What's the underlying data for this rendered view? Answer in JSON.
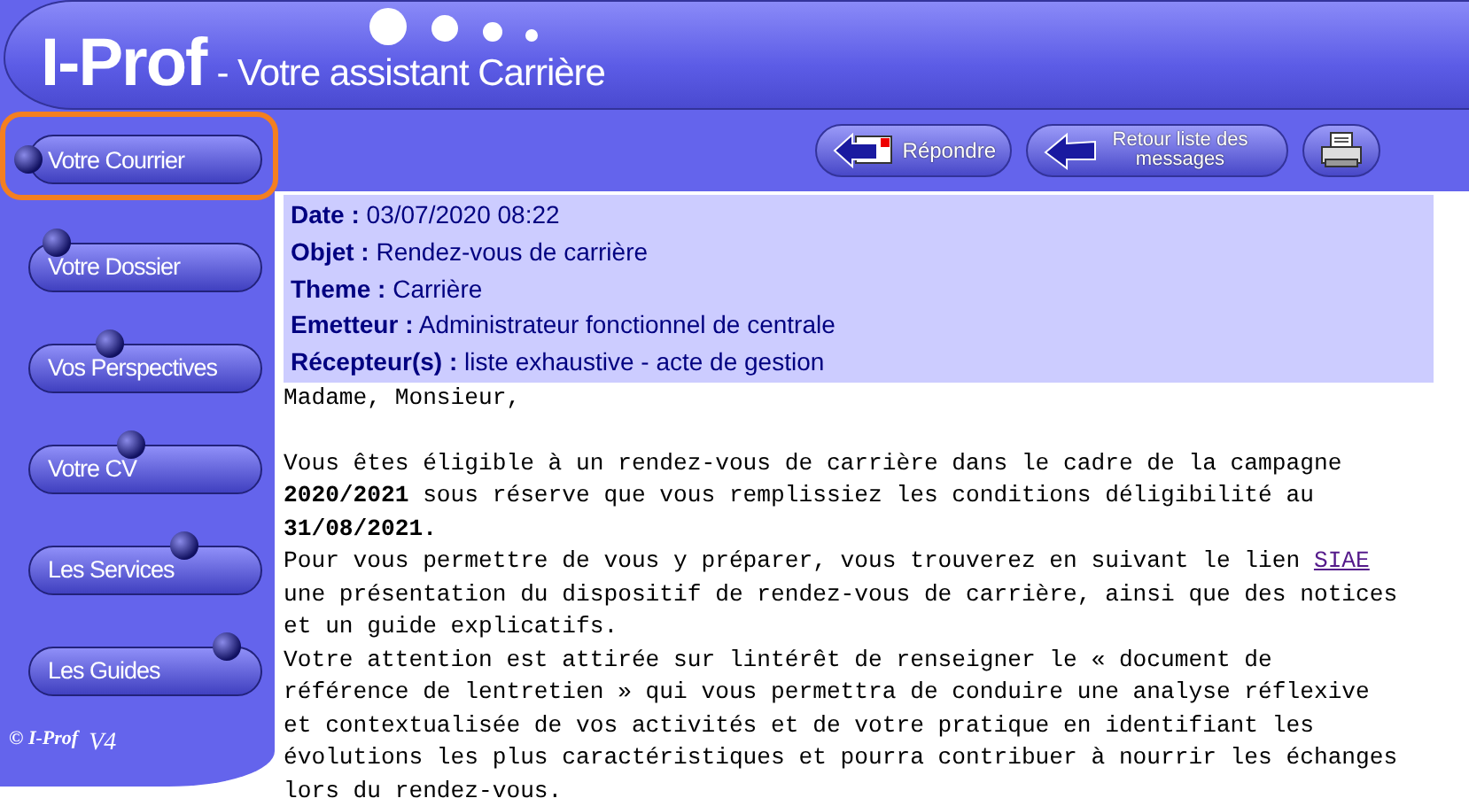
{
  "header": {
    "brand": "I-Prof",
    "subtitle": "- Votre assistant Carrière"
  },
  "sidebar": {
    "items": [
      {
        "label": "Votre Courrier",
        "highlighted": true
      },
      {
        "label": "Votre Dossier",
        "highlighted": false
      },
      {
        "label": "Vos Perspectives",
        "highlighted": false
      },
      {
        "label": "Votre CV",
        "highlighted": false
      },
      {
        "label": "Les Services",
        "highlighted": false
      },
      {
        "label": "Les Guides",
        "highlighted": false
      }
    ],
    "footer_brand": "© I-Prof",
    "footer_version": "V4"
  },
  "toolbar": [
    {
      "kind": "reply",
      "label": "Répondre"
    },
    {
      "kind": "back",
      "label": "Retour liste des messages"
    },
    {
      "kind": "print"
    }
  ],
  "message": {
    "fields": [
      {
        "label": "Date :",
        "value": "03/07/2020 08:22"
      },
      {
        "label": "Objet :",
        "value": "Rendez-vous de carrière"
      },
      {
        "label": "Theme :",
        "value": "Carrière"
      },
      {
        "label": "Emetteur :",
        "value": "Administrateur fonctionnel de centrale"
      },
      {
        "label": "Récepteur(s) :",
        "value": "liste exhaustive - acte de gestion"
      }
    ],
    "lines": [
      {
        "text": "Madame, Monsieur,"
      },
      {
        "kind": "blank"
      },
      {
        "text": "Vous êtes éligible à un rendez-vous de carrière dans le cadre de la campagne"
      },
      {
        "text": "**2020/2021** sous réserve que vous remplissiez les conditions déligibilité au"
      },
      {
        "text": "**31/08/2021.**"
      },
      {
        "text": "Pour vous permettre de vous y préparer, vous trouverez en suivant le lien ",
        "link": "SIAE"
      },
      {
        "text": "une présentation du dispositif de rendez-vous de carrière, ainsi que des notices"
      },
      {
        "text": "et un guide explicatifs."
      },
      {
        "text": "Votre attention est attirée sur lintérêt de renseigner le « document de"
      },
      {
        "text": "référence de lentretien » qui vous permettra de conduire une analyse réflexive"
      },
      {
        "text": "et contextualisée de vos activités et de votre pratique en identifiant les"
      },
      {
        "text": "évolutions les plus caractéristiques et pourra contribuer à nourrir les échanges"
      },
      {
        "text": "lors du rendez-vous."
      }
    ]
  }
}
